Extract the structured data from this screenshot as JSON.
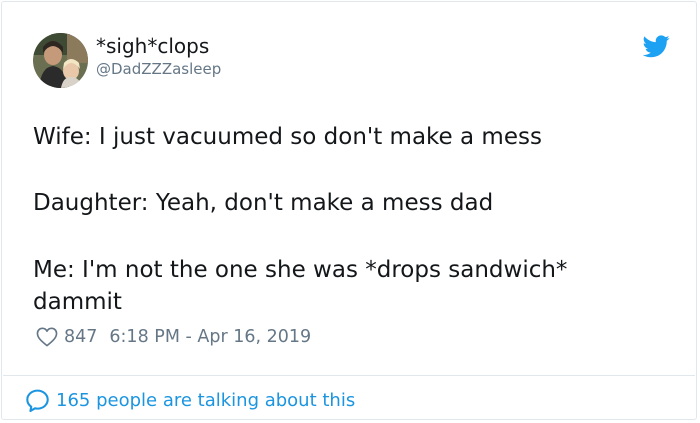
{
  "author": {
    "display_name": "*sigh*clops",
    "handle": "@DadZZZasleep"
  },
  "tweet": {
    "lines": [
      "Wife: I just vacuumed so don't make a mess",
      "Daughter: Yeah, don't make a mess dad",
      "Me: I'm not the one she was *drops sandwich*",
      "dammit"
    ]
  },
  "meta": {
    "likes": "847",
    "timestamp": "6:18 PM - Apr 16, 2019"
  },
  "footer": {
    "talking_text": "165 people are talking about this"
  },
  "icons": {
    "brand": "twitter-bird-icon",
    "like": "heart-icon",
    "reply": "speech-bubble-icon"
  },
  "colors": {
    "twitter_blue": "#1da1f2",
    "link_blue": "#1b95e0",
    "secondary_text": "#657786",
    "primary_text": "#14171a",
    "border": "#e1e8ed"
  }
}
